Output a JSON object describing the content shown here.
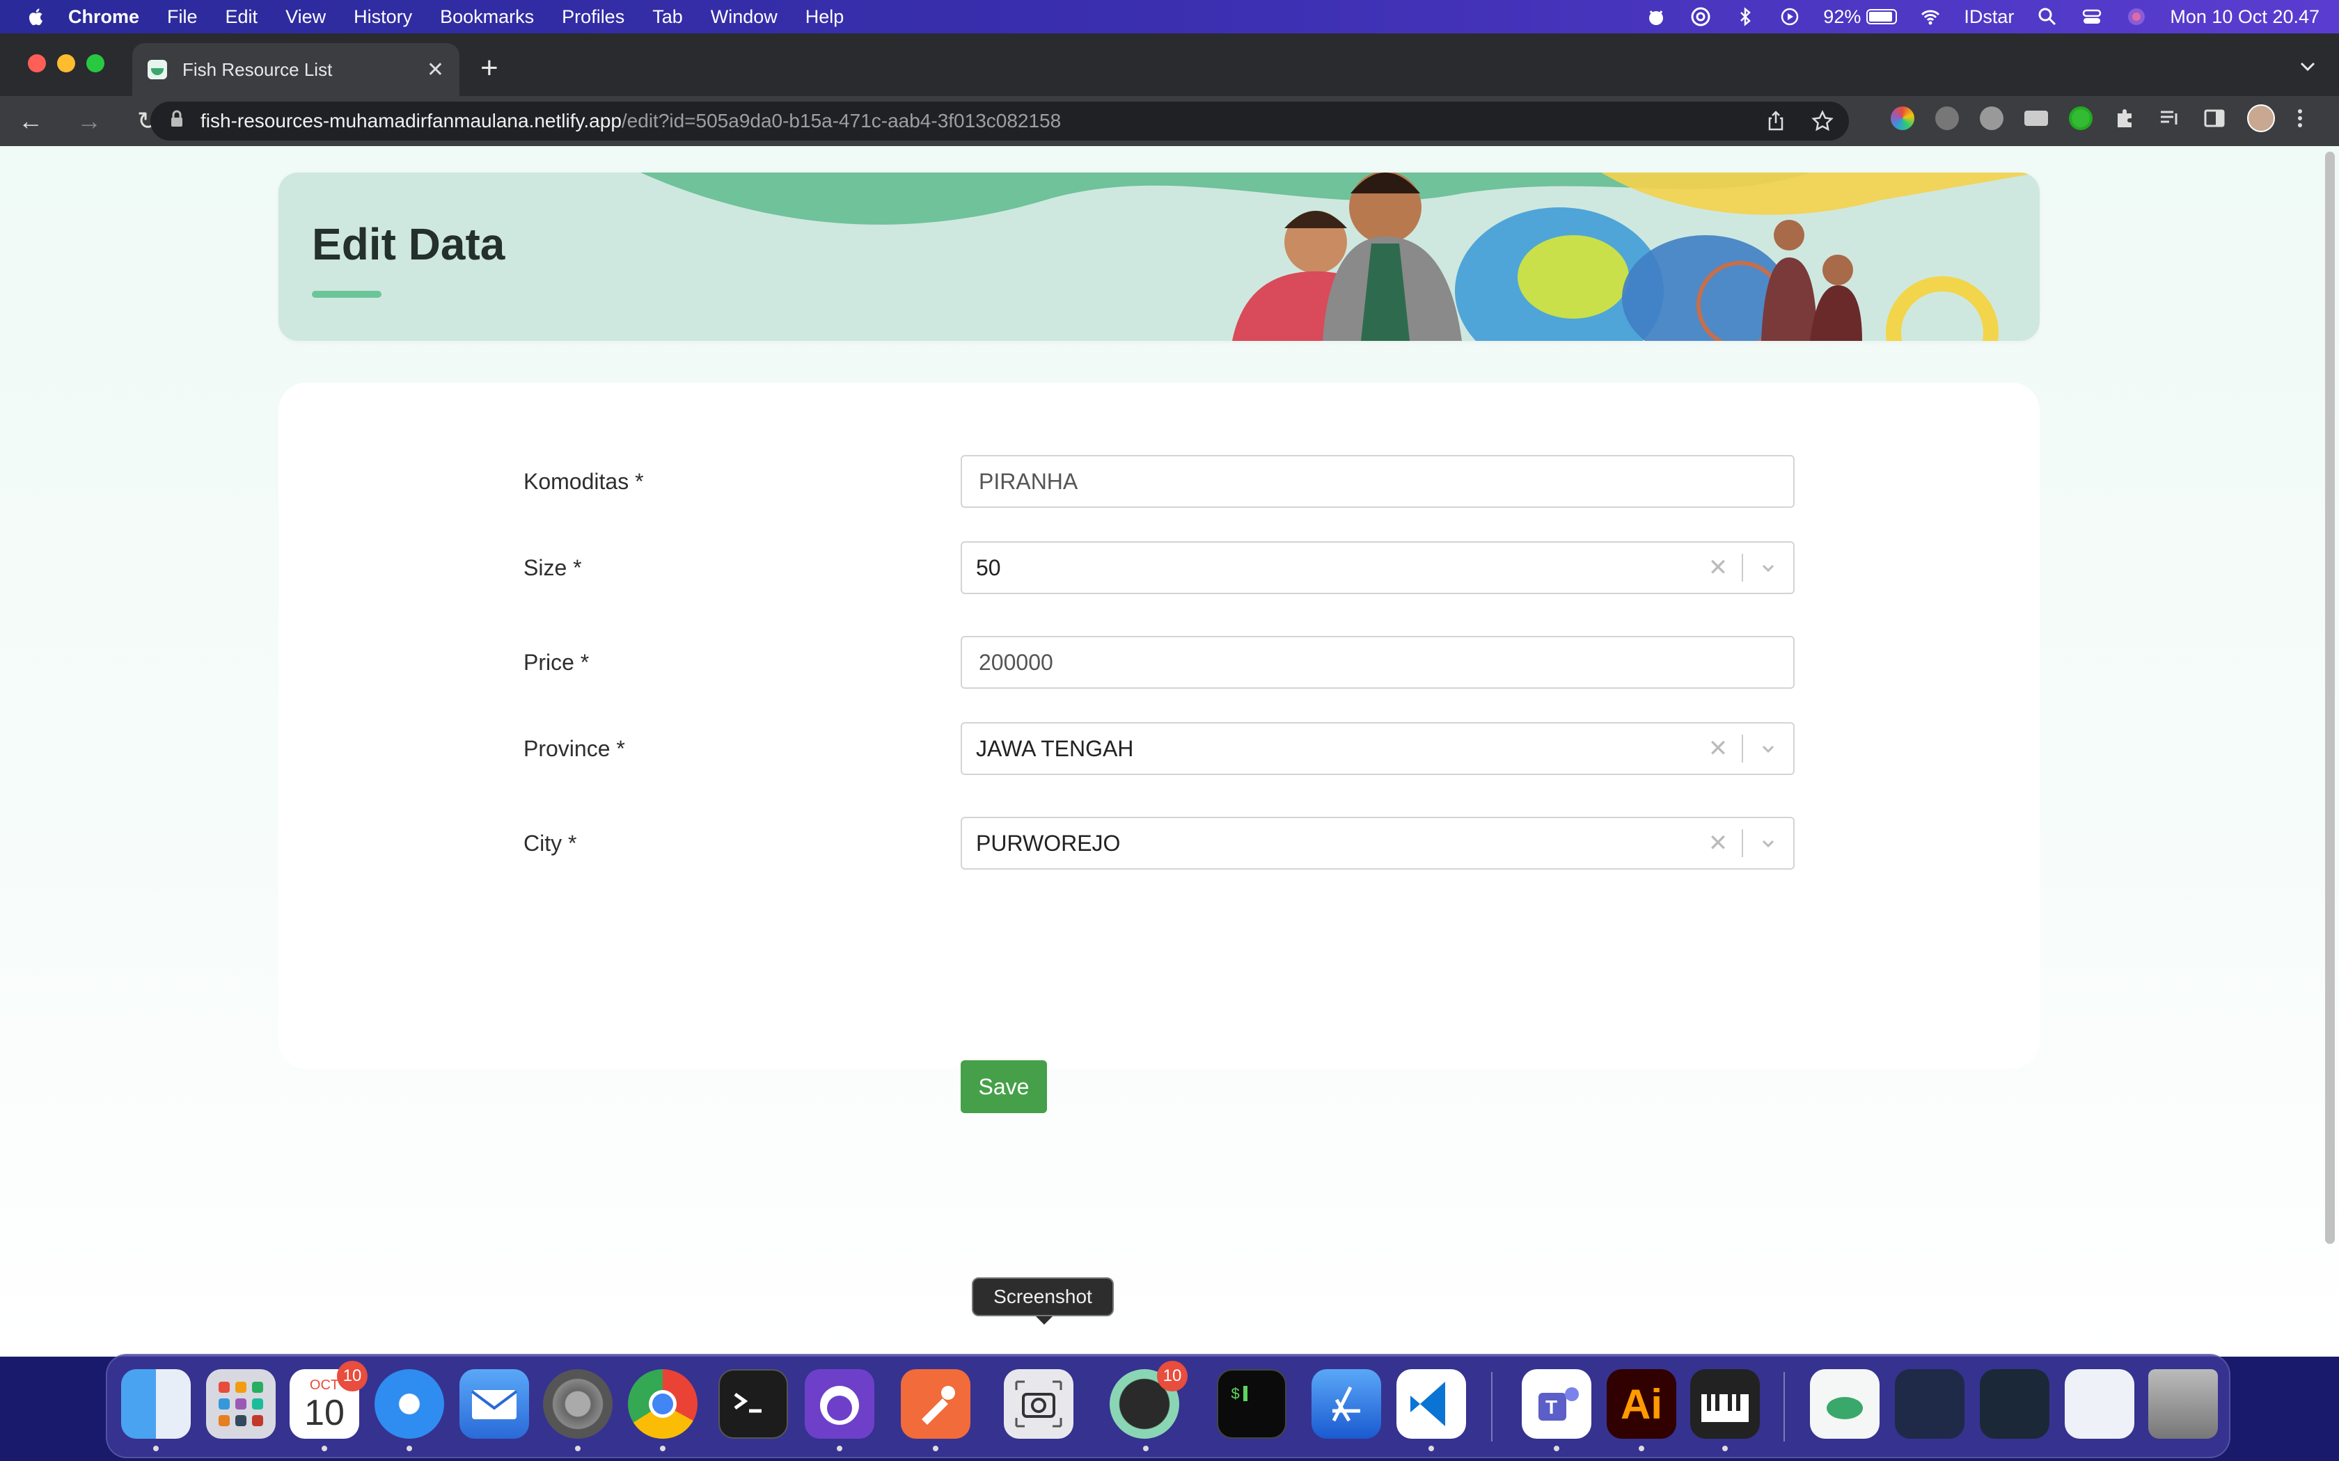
{
  "menubar": {
    "app": "Chrome",
    "items": [
      "File",
      "Edit",
      "View",
      "History",
      "Bookmarks",
      "Profiles",
      "Tab",
      "Window",
      "Help"
    ],
    "battery": "92%",
    "user": "IDstar",
    "clock": "Mon 10 Oct 20.47"
  },
  "browser": {
    "tab_title": "Fish Resource List",
    "url_host": "fish-resources-muhamadirfanmaulana.netlify.app",
    "url_path": "/edit?id=505a9da0-b15a-471c-aab4-3f013c082158"
  },
  "header": {
    "title": "Edit Data"
  },
  "form": {
    "komoditas": {
      "label": "Komoditas *",
      "value": "PIRANHA"
    },
    "size": {
      "label": "Size *",
      "value": "50"
    },
    "price": {
      "label": "Price *",
      "value": "200000"
    },
    "province": {
      "label": "Province *",
      "value": "JAWA TENGAH"
    },
    "city": {
      "label": "City *",
      "value": "PURWOREJO"
    },
    "save_label": "Save"
  },
  "dock": {
    "tooltip": "Screenshot",
    "calendar_month": "OCT",
    "calendar_day": "10",
    "calendar_badge": "10",
    "app_badge": "10",
    "illustrator_label": "Ai"
  },
  "colors": {
    "accent": "#45a049",
    "header_bg": "#cfe8df",
    "underline": "#6cc49a"
  }
}
